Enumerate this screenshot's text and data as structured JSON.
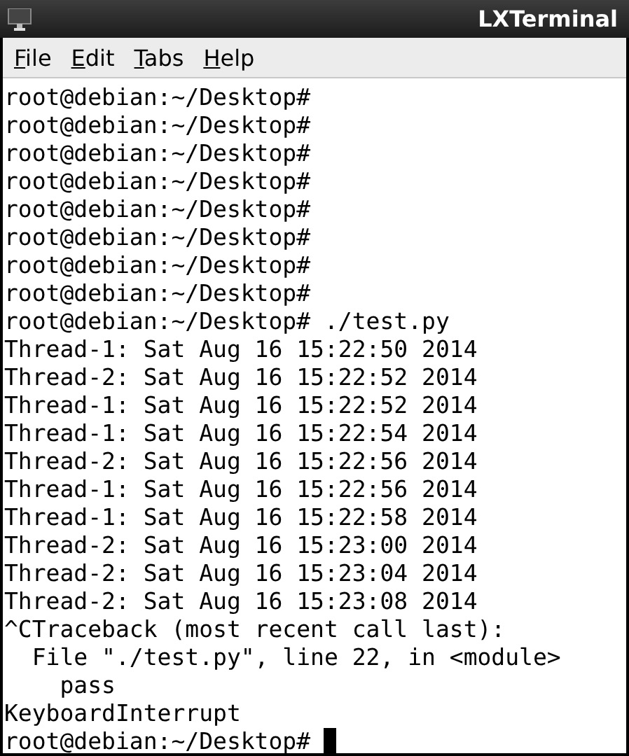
{
  "window": {
    "title": "LXTerminal"
  },
  "menu": [
    {
      "label": "File",
      "underline_first": true
    },
    {
      "label": "Edit",
      "underline_first": true
    },
    {
      "label": "Tabs",
      "underline_first": true
    },
    {
      "label": "Help",
      "underline_first": true
    }
  ],
  "terminal": {
    "lines": [
      "root@debian:~/Desktop#",
      "root@debian:~/Desktop#",
      "root@debian:~/Desktop#",
      "root@debian:~/Desktop#",
      "root@debian:~/Desktop#",
      "root@debian:~/Desktop#",
      "root@debian:~/Desktop#",
      "root@debian:~/Desktop#",
      "root@debian:~/Desktop# ./test.py",
      "Thread-1: Sat Aug 16 15:22:50 2014",
      "Thread-2: Sat Aug 16 15:22:52 2014",
      "Thread-1: Sat Aug 16 15:22:52 2014",
      "Thread-1: Sat Aug 16 15:22:54 2014",
      "Thread-2: Sat Aug 16 15:22:56 2014",
      "Thread-1: Sat Aug 16 15:22:56 2014",
      "Thread-1: Sat Aug 16 15:22:58 2014",
      "Thread-2: Sat Aug 16 15:23:00 2014",
      "Thread-2: Sat Aug 16 15:23:04 2014",
      "Thread-2: Sat Aug 16 15:23:08 2014",
      "^CTraceback (most recent call last):",
      "  File \"./test.py\", line 22, in <module>",
      "    pass",
      "KeyboardInterrupt",
      "root@debian:~/Desktop# "
    ],
    "cursor": true
  }
}
